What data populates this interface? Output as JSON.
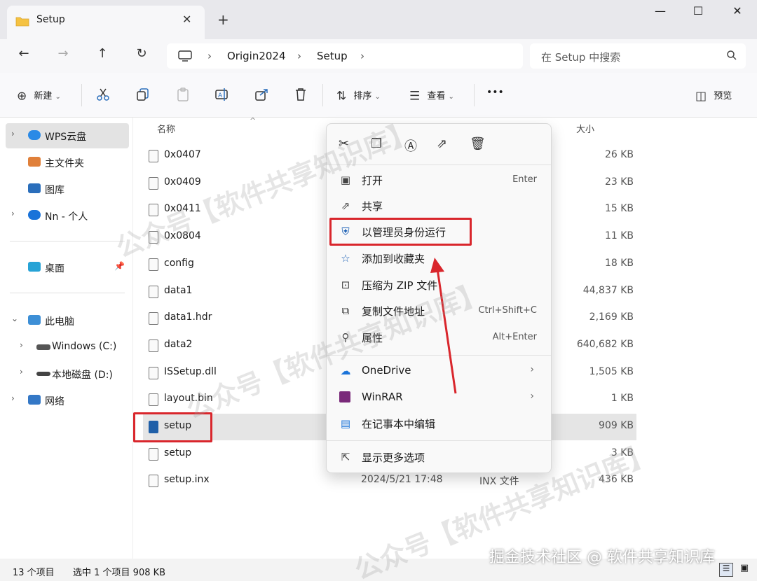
{
  "window": {
    "tab_title": "Setup",
    "tab_close": "✕",
    "new_tab": "+",
    "minimize": "—",
    "maximize": "☐",
    "close": "✕"
  },
  "nav": {
    "back": "←",
    "forward": "→",
    "up": "↑",
    "refresh": "↻",
    "breadcrumb": [
      "Origin2024",
      "Setup"
    ],
    "search_placeholder": "在 Setup 中搜索"
  },
  "commandbar": {
    "new_label": "新建",
    "sort_label": "排序",
    "view_label": "查看",
    "more": "•••",
    "preview_label": "预览"
  },
  "sidebar": {
    "items": [
      {
        "label": "WPS云盘"
      },
      {
        "label": "主文件夹"
      },
      {
        "label": "图库"
      },
      {
        "label": "Nn - 个人"
      },
      {
        "label": "桌面"
      },
      {
        "label": "此电脑"
      },
      {
        "label": "Windows (C:)"
      },
      {
        "label": "本地磁盘 (D:)"
      },
      {
        "label": "网络"
      }
    ]
  },
  "columns": {
    "name": "名称",
    "size": "大小"
  },
  "files": [
    {
      "name": "0x0407",
      "date": "",
      "type": "",
      "size": "26 KB"
    },
    {
      "name": "0x0409",
      "date": "",
      "type": "",
      "size": "23 KB"
    },
    {
      "name": "0x0411",
      "date": "",
      "type": "",
      "size": "15 KB"
    },
    {
      "name": "0x0804",
      "date": "",
      "type": "",
      "size": "11 KB"
    },
    {
      "name": "config",
      "date": "",
      "type": "",
      "size": "18 KB"
    },
    {
      "name": "data1",
      "date": "",
      "type": "",
      "size": "44,837 KB"
    },
    {
      "name": "data1.hdr",
      "date": "",
      "type": "",
      "size": "2,169 KB"
    },
    {
      "name": "data2",
      "date": "",
      "type": "",
      "size": "640,682 KB"
    },
    {
      "name": "ISSetup.dll",
      "date": "",
      "type": "",
      "size": "1,505 KB"
    },
    {
      "name": "layout.bin",
      "date": "",
      "type": "",
      "size": "1 KB"
    },
    {
      "name": "setup",
      "date": "",
      "type": "",
      "size": "909 KB"
    },
    {
      "name": "setup",
      "date": "",
      "type": "",
      "size": "3 KB"
    },
    {
      "name": "setup.inx",
      "date": "2024/5/21 17:48",
      "type": "INX 文件",
      "size": "436 KB"
    }
  ],
  "context_menu": {
    "items": [
      {
        "label": "打开",
        "shortcut": "Enter"
      },
      {
        "label": "共享",
        "shortcut": ""
      },
      {
        "label": "以管理员身份运行",
        "shortcut": ""
      },
      {
        "label": "添加到收藏夹",
        "shortcut": ""
      },
      {
        "label": "压缩为 ZIP 文件",
        "shortcut": ""
      },
      {
        "label": "复制文件地址",
        "shortcut": "Ctrl+Shift+C"
      },
      {
        "label": "属性",
        "shortcut": "Alt+Enter"
      },
      {
        "label": "OneDrive",
        "shortcut": ""
      },
      {
        "label": "WinRAR",
        "shortcut": ""
      },
      {
        "label": "在记事本中编辑",
        "shortcut": ""
      },
      {
        "label": "显示更多选项",
        "shortcut": ""
      }
    ]
  },
  "status": {
    "count": "13 个项目",
    "selected": "选中 1 个项目  908 KB"
  },
  "watermarks": {
    "text1": "公众号【软件共享知识库】",
    "footer": "掘金技术社区 @ 软件共享知识库"
  },
  "colors": {
    "highlight_red": "#d9262c",
    "accent_blue": "#0067c0"
  }
}
